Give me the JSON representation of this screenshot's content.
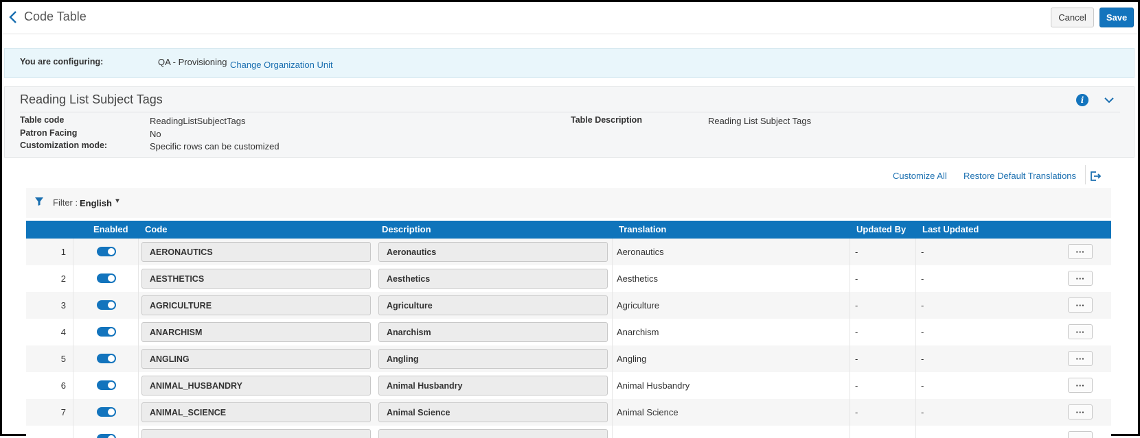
{
  "header": {
    "title": "Code Table",
    "cancel_label": "Cancel",
    "save_label": "Save"
  },
  "config": {
    "label": "You are configuring:",
    "value": "QA - Provisioning",
    "change_link": "Change Organization Unit"
  },
  "details": {
    "title": "Reading List Subject Tags",
    "table_code_label": "Table code",
    "table_code_value": "ReadingListSubjectTags",
    "patron_facing_label": "Patron Facing",
    "patron_facing_value": "No",
    "customization_mode_label": "Customization mode:",
    "customization_mode_value": "Specific rows can be customized",
    "table_description_label": "Table Description",
    "table_description_value": "Reading List Subject Tags"
  },
  "actions": {
    "customize_all": "Customize All",
    "restore_default": "Restore Default Translations"
  },
  "filter": {
    "label": "Filter :",
    "value": "English"
  },
  "table": {
    "columns": [
      "Enabled",
      "Code",
      "Description",
      "Translation",
      "Updated By",
      "Last Updated"
    ],
    "rows": [
      {
        "num": "1",
        "enabled": true,
        "code": "AERONAUTICS",
        "description": "Aeronautics",
        "translation": "Aeronautics",
        "updated_by": "-",
        "last_updated": "-"
      },
      {
        "num": "2",
        "enabled": true,
        "code": "AESTHETICS",
        "description": "Aesthetics",
        "translation": "Aesthetics",
        "updated_by": "-",
        "last_updated": "-"
      },
      {
        "num": "3",
        "enabled": true,
        "code": "AGRICULTURE",
        "description": "Agriculture",
        "translation": "Agriculture",
        "updated_by": "-",
        "last_updated": "-"
      },
      {
        "num": "4",
        "enabled": true,
        "code": "ANARCHISM",
        "description": "Anarchism",
        "translation": "Anarchism",
        "updated_by": "-",
        "last_updated": "-"
      },
      {
        "num": "5",
        "enabled": true,
        "code": "ANGLING",
        "description": "Angling",
        "translation": "Angling",
        "updated_by": "-",
        "last_updated": "-"
      },
      {
        "num": "6",
        "enabled": true,
        "code": "ANIMAL_HUSBANDRY",
        "description": "Animal Husbandry",
        "translation": "Animal Husbandry",
        "updated_by": "-",
        "last_updated": "-"
      },
      {
        "num": "7",
        "enabled": true,
        "code": "ANIMAL_SCIENCE",
        "description": "Animal Science",
        "translation": "Animal Science",
        "updated_by": "-",
        "last_updated": "-"
      },
      {
        "num": "",
        "enabled": true,
        "code": "",
        "description": "",
        "translation": "",
        "updated_by": "",
        "last_updated": ""
      }
    ],
    "more_label": "···"
  },
  "colors": {
    "primary": "#1374bd",
    "header_blue": "#0f74bb",
    "config_bg": "#e9f6fb"
  }
}
